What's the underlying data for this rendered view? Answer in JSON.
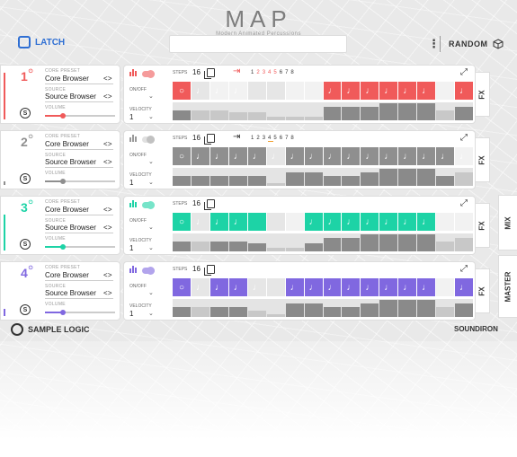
{
  "header": {
    "title": "MAP",
    "subtitle": "Modern Animated Percussions",
    "latch_label": "LATCH",
    "random_label": "RANDOM"
  },
  "colors": {
    "track1": "#f05a5a",
    "track2": "#8f8f8f",
    "track3": "#1dd3a6",
    "track4": "#8068e0",
    "latch": "#2f6fd3"
  },
  "labels": {
    "core_preset": "CORE PRESET",
    "source": "SOURCE",
    "volume": "VOLUME",
    "steps": "STEPS",
    "on_off": "ON/OFF",
    "velocity": "VELOCITY",
    "fx": "FX",
    "mix": "MIX",
    "master": "MASTER",
    "s_button": "S",
    "arrows": "< >"
  },
  "tracks": [
    {
      "number": "1",
      "preset": "Core Browser",
      "source": "Source Browser",
      "steps": "16",
      "velocity": "1",
      "route_numbers": [
        "1",
        "2",
        "3",
        "4",
        "5",
        "6",
        "7",
        "8"
      ],
      "cells": [
        "o",
        "d",
        "d",
        "d",
        "",
        "",
        "",
        "",
        "d",
        "d",
        "d",
        "d",
        "d",
        "d",
        "",
        "d"
      ],
      "active": [
        1,
        0,
        0,
        0,
        0,
        0,
        0,
        0,
        1,
        1,
        1,
        1,
        1,
        1,
        0,
        1
      ],
      "vel": [
        0.55,
        0.55,
        0.55,
        0.45,
        0.45,
        0.2,
        0.2,
        0.2,
        0.75,
        0.75,
        0.75,
        0.95,
        0.95,
        0.95,
        0.55,
        0.75
      ]
    },
    {
      "number": "2",
      "preset": "Core Browser",
      "source": "Source Browser",
      "steps": "16",
      "velocity": "1",
      "route_numbers": [
        "1",
        "2",
        "3",
        "4",
        "5",
        "6",
        "7",
        "8"
      ],
      "cells": [
        "o",
        "d",
        "d",
        "d",
        "d",
        "d",
        "d",
        "d",
        "d",
        "d",
        "d",
        "d",
        "d",
        "d",
        "d",
        "d"
      ],
      "active": [
        1,
        1,
        1,
        1,
        1,
        0,
        1,
        1,
        1,
        1,
        1,
        1,
        1,
        1,
        1,
        0
      ],
      "vel": [
        0.55,
        0.55,
        0.55,
        0.55,
        0.55,
        0.15,
        0.75,
        0.75,
        0.55,
        0.55,
        0.75,
        0.95,
        0.95,
        0.95,
        0.55,
        0.75
      ]
    },
    {
      "number": "3",
      "preset": "Core Browser",
      "source": "Source Browser",
      "steps": "16",
      "velocity": "1",
      "route_numbers": [],
      "cells": [
        "o",
        "d",
        "d",
        "d",
        "",
        "",
        "",
        "d",
        "d",
        "d",
        "d",
        "d",
        "d",
        "d",
        "",
        ""
      ],
      "active": [
        1,
        0,
        1,
        1,
        1,
        0,
        0,
        1,
        1,
        1,
        1,
        1,
        1,
        1,
        0,
        0
      ],
      "vel": [
        0.55,
        0.55,
        0.55,
        0.55,
        0.45,
        0.2,
        0.2,
        0.45,
        0.75,
        0.75,
        0.95,
        0.95,
        0.95,
        0.95,
        0.55,
        0.75
      ]
    },
    {
      "number": "4",
      "preset": "Core Browser",
      "source": "Source Browser",
      "steps": "16",
      "velocity": "1",
      "route_numbers": [],
      "cells": [
        "o",
        "d",
        "d",
        "d",
        "d",
        "",
        "d",
        "d",
        "d",
        "d",
        "d",
        "d",
        "d",
        "d",
        "",
        "d"
      ],
      "active": [
        1,
        0,
        1,
        1,
        0,
        0,
        1,
        1,
        1,
        1,
        1,
        1,
        1,
        1,
        0,
        1
      ],
      "vel": [
        0.55,
        0.55,
        0.55,
        0.55,
        0.35,
        0.15,
        0.75,
        0.75,
        0.55,
        0.55,
        0.75,
        0.95,
        0.95,
        0.95,
        0.55,
        0.75
      ]
    }
  ],
  "footer": {
    "left": "SAMPLE LOGIC",
    "right": "SOUNDIRON"
  }
}
